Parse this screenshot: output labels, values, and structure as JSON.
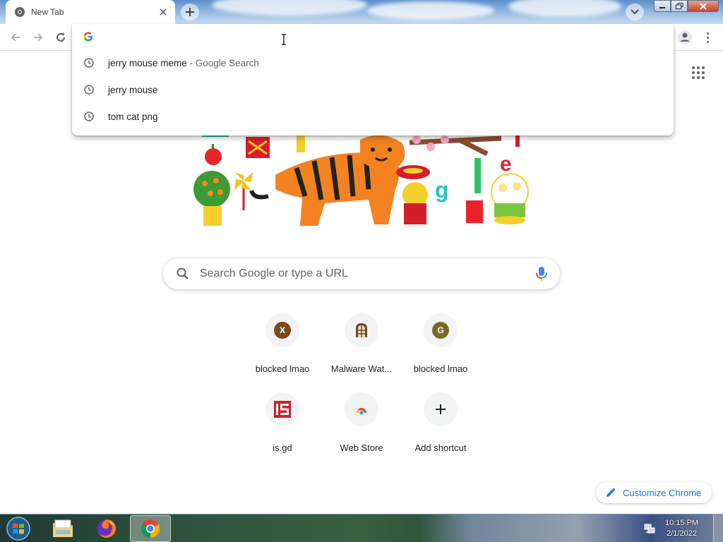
{
  "browser": {
    "tab": {
      "title": "New Tab",
      "favicon": "chrome-icon"
    },
    "new_tab_icon": "plus-icon",
    "tab_search_icon": "chevron-down-icon",
    "window_controls": {
      "minimize": "minimize-icon",
      "maximize": "maximize-icon",
      "close": "close-icon"
    }
  },
  "toolbar": {
    "back_icon": "arrow-left-icon",
    "forward_icon": "arrow-right-icon",
    "reload_icon": "reload-icon",
    "profile_icon": "person-icon",
    "menu_icon": "kebab-menu-icon"
  },
  "omnibox": {
    "value": "",
    "engine_icon": "google-g-icon",
    "suggestions": [
      {
        "text": "jerry mouse meme",
        "description": " - Google Search",
        "icon": "history-clock-icon"
      },
      {
        "text": "jerry mouse",
        "description": "",
        "icon": "history-clock-icon"
      },
      {
        "text": "tom cat png",
        "description": "",
        "icon": "history-clock-icon"
      }
    ]
  },
  "ntp": {
    "apps_icon": "apps-grid-icon",
    "doodle_alt": "Google Doodle - Lunar New Year tiger",
    "search": {
      "placeholder": "Search Google or type a URL",
      "value": "",
      "icon": "search-icon",
      "voice_icon": "microphone-icon"
    },
    "shortcuts": [
      {
        "label": "blocked lmao",
        "letter": "X",
        "color": "#7a4a1c"
      },
      {
        "label": "Malware Wat...",
        "icon": "malware-watch-icon"
      },
      {
        "label": "blocked lmao",
        "letter": "G",
        "color": "#7a6a28"
      },
      {
        "label": "is.gd",
        "icon": "isgd-icon"
      },
      {
        "label": "Web Store",
        "icon": "web-store-icon"
      },
      {
        "label": "Add shortcut",
        "icon": "plus-icon"
      }
    ],
    "customize_label": "Customize Chrome",
    "customize_icon": "pencil-icon"
  },
  "taskbar": {
    "start_icon": "windows-start-icon",
    "items": [
      {
        "name": "file-explorer",
        "icon": "folder-icon",
        "active": false
      },
      {
        "name": "firefox",
        "icon": "firefox-icon",
        "active": false
      },
      {
        "name": "chrome",
        "icon": "chrome-icon",
        "active": true
      }
    ],
    "tray_icon": "network-icon",
    "time": "10:15 PM",
    "date": "2/1/2022"
  }
}
